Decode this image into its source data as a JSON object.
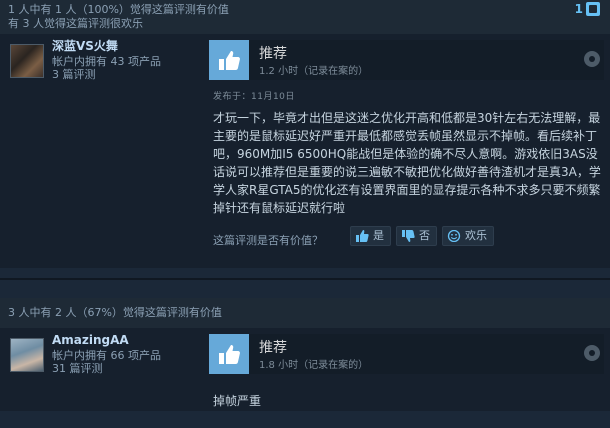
{
  "review1": {
    "helpful_line": "1 人中有 1 人（100%）觉得这篇评测有价值",
    "funny_line": "有 3 人觉得这篇评测很欢乐",
    "award_count": "1",
    "author_name": "深蓝VS火舞",
    "products_owned": "帐户内拥有 43 项产品",
    "review_count": "3 篇评测",
    "verdict": "推荐",
    "hours": "1.2 小时（记录在案的）",
    "posted": "发布于：11月10日",
    "text": "才玩一下，毕竟才出但是这迷之优化开高和低都是30针左右无法理解，最主要的是鼠标延迟好严重开最低都感觉丢帧虽然显示不掉帧。看后续补丁吧，960M加I5 6500HQ能战但是体验的确不尽人意啊。游戏依旧3AS没话说可以推荐但是重要的说三遍敏不敏把优化做好善待渣机才是真3A，学学人家R星GTA5的优化还有设置界面里的显存提示各种不求多只要不频繁掉针还有鼠标延迟就行啦",
    "helpful_question": "这篇评测是否有价值？",
    "btn_yes": "是",
    "btn_no": "否",
    "btn_funny": "欢乐"
  },
  "review2": {
    "helpful_line": "3 人中有 2 人（67%）觉得这篇评测有价值",
    "author_name": "AmazingAA",
    "products_owned": "帐户内拥有 66 项产品",
    "review_count": "31 篇评测",
    "verdict": "推荐",
    "hours": "1.8 小时（记录在案的）",
    "text": "掉帧严重"
  },
  "icons": {
    "thumb": "thumbs-up-icon",
    "steam": "steam-icon",
    "award": "award-icon"
  },
  "colors": {
    "background": "#1b2838",
    "accent": "#66c0f4",
    "thumb_box": "#66a9d9"
  }
}
